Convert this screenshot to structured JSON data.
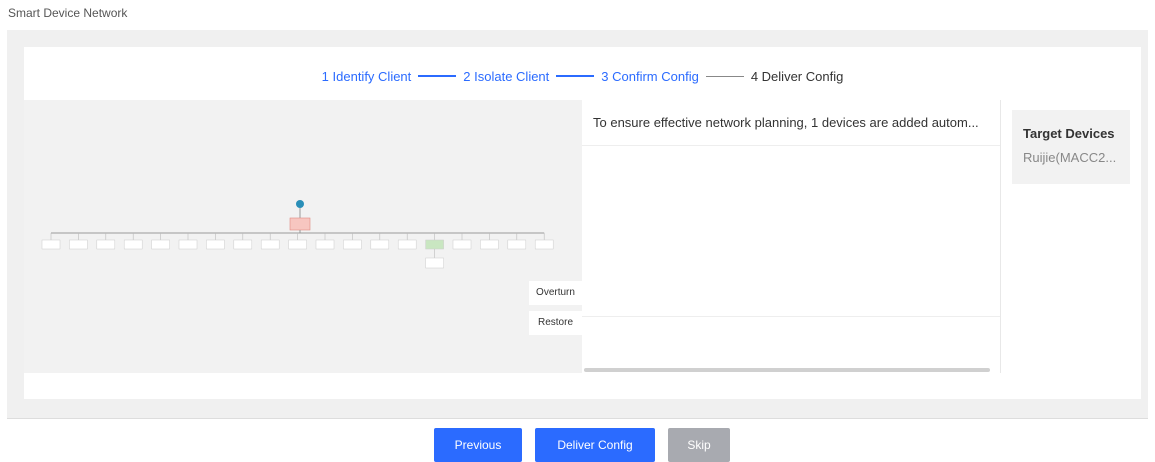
{
  "page": {
    "title": "Smart Device Network"
  },
  "steps": [
    {
      "label": "1 Identify Client",
      "state": "done"
    },
    {
      "label": "2 Isolate Client",
      "state": "done"
    },
    {
      "label": "3 Confirm Config",
      "state": "active"
    },
    {
      "label": "4 Deliver Config",
      "state": "pending"
    }
  ],
  "topology": {
    "overturn_label": "Overturn",
    "restore_label": "Restore",
    "root_color": "#2a8fb8",
    "switch_color": "#f7c6c0",
    "highlight_color": "#c9e6c1"
  },
  "message": {
    "text": "To ensure effective network planning, 1 devices are added autom..."
  },
  "target": {
    "title": "Target Devices",
    "device": "Ruijie(MACC2..."
  },
  "buttons": {
    "previous": "Previous",
    "deliver": "Deliver Config",
    "skip": "Skip"
  },
  "colors": {
    "accent": "#2b6bff",
    "disabled": "#a8aab0"
  }
}
